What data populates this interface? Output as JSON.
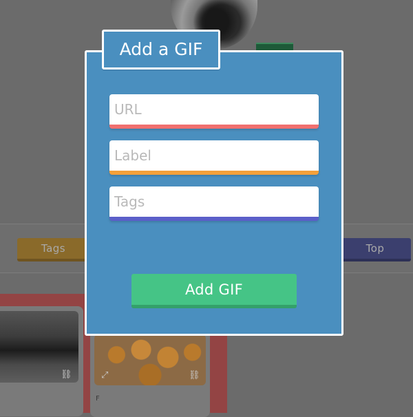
{
  "modal": {
    "title": "Add a GIF",
    "fields": {
      "url_placeholder": "URL",
      "label_placeholder": "Label",
      "tags_placeholder": "Tags"
    },
    "submit_label": "Add GIF",
    "colors": {
      "panel": "#4a8fbf",
      "url_accent": "#f0706f",
      "label_accent": "#f4a03a",
      "tags_accent": "#5b5fc9",
      "submit": "#45c486"
    }
  },
  "background": {
    "tabs": {
      "tags_label": "Tags",
      "top_label": "Top"
    },
    "card_letter": "F"
  }
}
